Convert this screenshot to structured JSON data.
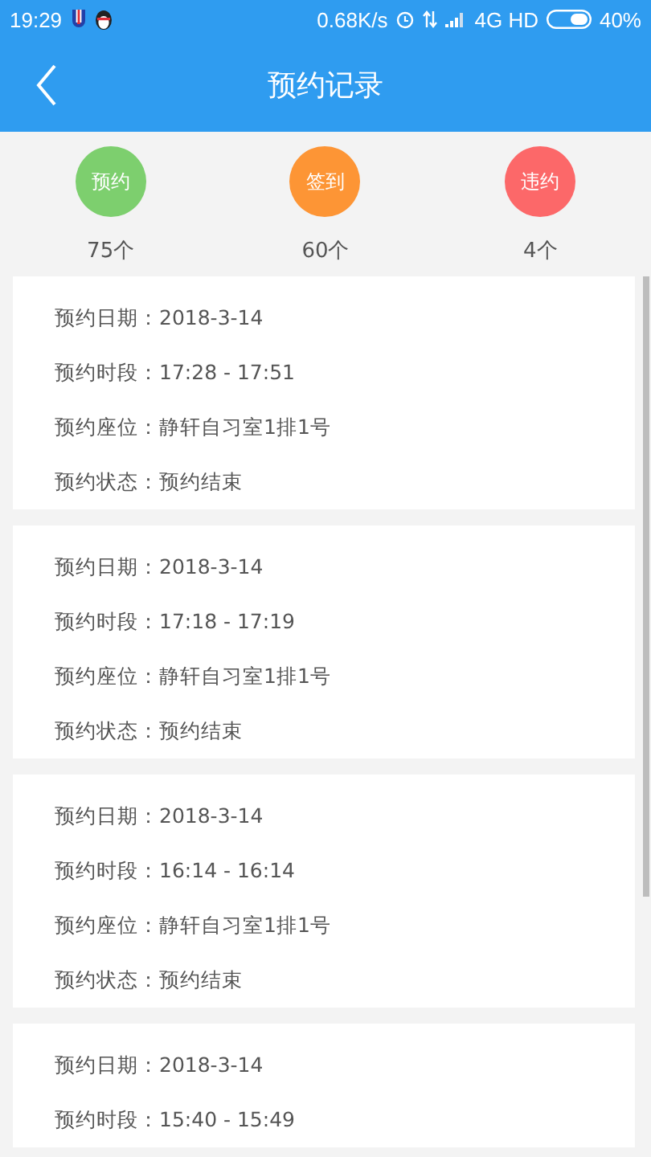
{
  "status_bar": {
    "time": "19:29",
    "speed": "0.68K/s",
    "network": "4G HD",
    "battery": "40%"
  },
  "header": {
    "title": "预约记录"
  },
  "stats": [
    {
      "label": "预约",
      "count": "75个",
      "color": "#7dcf6e"
    },
    {
      "label": "签到",
      "count": "60个",
      "color": "#fd9535"
    },
    {
      "label": "违约",
      "count": "4个",
      "color": "#fc6869"
    }
  ],
  "records": [
    {
      "lines": [
        "预约日期：2018-3-14",
        "预约时段：17:28 - 17:51",
        "预约座位：静轩自习室1排1号",
        "预约状态：预约结束"
      ]
    },
    {
      "lines": [
        "预约日期：2018-3-14",
        "预约时段：17:18 - 17:19",
        "预约座位：静轩自习室1排1号",
        "预约状态：预约结束"
      ]
    },
    {
      "lines": [
        "预约日期：2018-3-14",
        "预约时段：16:14 - 16:14",
        "预约座位：静轩自习室1排1号",
        "预约状态：预约结束"
      ]
    },
    {
      "lines": [
        "预约日期：2018-3-14",
        "预约时段：15:40 - 15:49"
      ]
    }
  ]
}
